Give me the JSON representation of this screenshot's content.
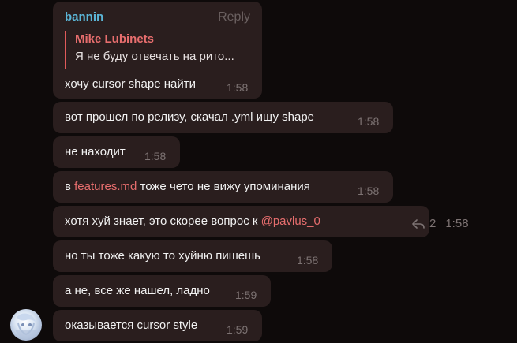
{
  "messages": [
    {
      "sender": "bannin",
      "reply_label": "Reply",
      "quote": {
        "author": "Mike Lubinets",
        "text": "Я не буду отвечать на рито..."
      },
      "text": "хочу cursor shape найти",
      "time": "1:58"
    },
    {
      "text": "вот прошел по релизу, скачал .yml ищу shape",
      "time": "1:58"
    },
    {
      "text": "не находит",
      "time": "1:58"
    },
    {
      "text_before": "в ",
      "link": "features.md",
      "text_after": " тоже чето не вижу упоминания",
      "time": "1:58"
    },
    {
      "text_before": "хотя хуй знает, это скорее вопрос к ",
      "mention": "@pavlus_0",
      "reply_count": "2",
      "time": "1:58"
    },
    {
      "text": "но ты тоже какую то хуйню пишешь",
      "time": "1:58"
    },
    {
      "text": "а не, все же нашел, ладно",
      "time": "1:59"
    },
    {
      "text": "оказывается cursor style",
      "time": "1:59"
    }
  ],
  "colors": {
    "background": "#0e0a0a",
    "bubble": "#2a1e1e",
    "sender_name": "#5bb5d6",
    "quote_accent": "#e05a5a",
    "mention": "#e76e6e",
    "time": "#7d7373"
  },
  "icons": {
    "replies": "reply-arrow-icon",
    "avatar": "user-avatar"
  }
}
